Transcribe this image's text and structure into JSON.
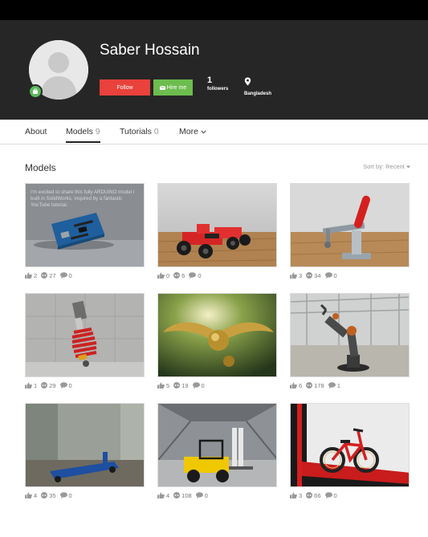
{
  "profile": {
    "name": "Saber Hossain",
    "follow_label": "Follow",
    "hire_label": "Hire me",
    "followers_count": "1",
    "followers_label": "followers",
    "location": "Bangladesh"
  },
  "tabs": [
    {
      "label": "About",
      "count": ""
    },
    {
      "label": "Models",
      "count": "9"
    },
    {
      "label": "Tutorials",
      "count": "0"
    },
    {
      "label": "More",
      "count": ""
    }
  ],
  "section": {
    "title": "Models",
    "sort_label": "Sort by: Recent"
  },
  "models": [
    {
      "caption": "I'm excited to share this fully ARDUINO model I built in SolidWorks, inspired by a fantastic YouTube tutorial.",
      "likes": "2",
      "views": "27",
      "comments": "0"
    },
    {
      "caption": "",
      "likes": "0",
      "views": "6",
      "comments": "0"
    },
    {
      "caption": "",
      "likes": "3",
      "views": "34",
      "comments": "0"
    },
    {
      "caption": "",
      "likes": "1",
      "views": "29",
      "comments": "0"
    },
    {
      "caption": "",
      "likes": "5",
      "views": "19",
      "comments": "0"
    },
    {
      "caption": "",
      "likes": "6",
      "views": "178",
      "comments": "1"
    },
    {
      "caption": "",
      "likes": "4",
      "views": "35",
      "comments": "0"
    },
    {
      "caption": "",
      "likes": "4",
      "views": "108",
      "comments": "0"
    },
    {
      "caption": "",
      "likes": "3",
      "views": "66",
      "comments": "0"
    }
  ],
  "icons": {
    "like": "thumbs-up-icon",
    "view": "eye-icon",
    "comment": "comment-icon",
    "pro": "pro-badge-icon",
    "location": "location-pin-icon",
    "hire": "envelope-icon",
    "dropdown": "chevron-down-icon"
  },
  "colors": {
    "follow": "#e9413b",
    "hire": "#6dbd4f",
    "hero_background": "#262626",
    "top_bar": "#000000"
  }
}
